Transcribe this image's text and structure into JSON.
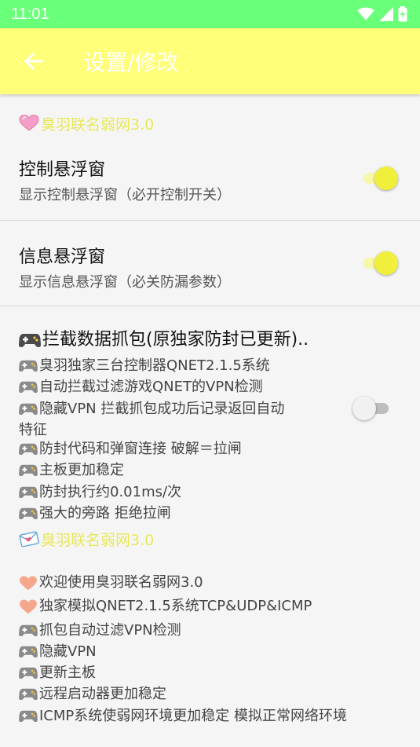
{
  "statusbar": {
    "time": "11:01"
  },
  "toolbar": {
    "title": "设置/修改"
  },
  "section1": {
    "header": "臭羽联名弱网3.0",
    "header_icon": "heart-icon",
    "pref_control": {
      "title": "控制悬浮窗",
      "summary": "显示控制悬浮窗（必开控制开关）",
      "checked": true
    },
    "pref_info": {
      "title": "信息悬浮窗",
      "summary": "显示信息悬浮窗（必关防漏参数）",
      "checked": true
    },
    "pref_intercept": {
      "title": "拦截数据抓包(原独家防封已更新)..",
      "checked": false,
      "lines": [
        "臭羽独家三台控制器QNET2.1.5系统",
        "自动拦截过滤游戏QNET的VPN检测",
        "隐藏VPN 拦截抓包成功后记录返回自动",
        "特征",
        "防封代码和弹窗连接 破解＝拉闸",
        "主板更加稳定",
        "防封执行约0.01ms/次",
        "强大的旁路 拒绝拉闸"
      ]
    }
  },
  "section2": {
    "header": "臭羽联名弱网3.0",
    "header_icon": "envelope-icon",
    "lines": [
      {
        "icon": "heart-icon",
        "text": "欢迎使用臭羽联名弱网3.0"
      },
      {
        "icon": "heart-icon",
        "text": "独家模拟QNET2.1.5系统TCP&UDP&ICMP"
      },
      {
        "icon": "gamepad-icon",
        "text": "抓包自动过滤VPN检测"
      },
      {
        "icon": "gamepad-icon",
        "text": "隐藏VPN"
      },
      {
        "icon": "gamepad-icon",
        "text": "更新主板"
      },
      {
        "icon": "gamepad-icon",
        "text": "远程启动器更加稳定"
      },
      {
        "icon": "gamepad-icon",
        "text": "ICMP系统使弱网环境更加稳定 模拟正常网络环境"
      }
    ]
  },
  "colors": {
    "statusbar": "#69ff78",
    "toolbar": "#ffff7a",
    "accent": "#f0f03c",
    "category_text": "#e8e85a"
  }
}
